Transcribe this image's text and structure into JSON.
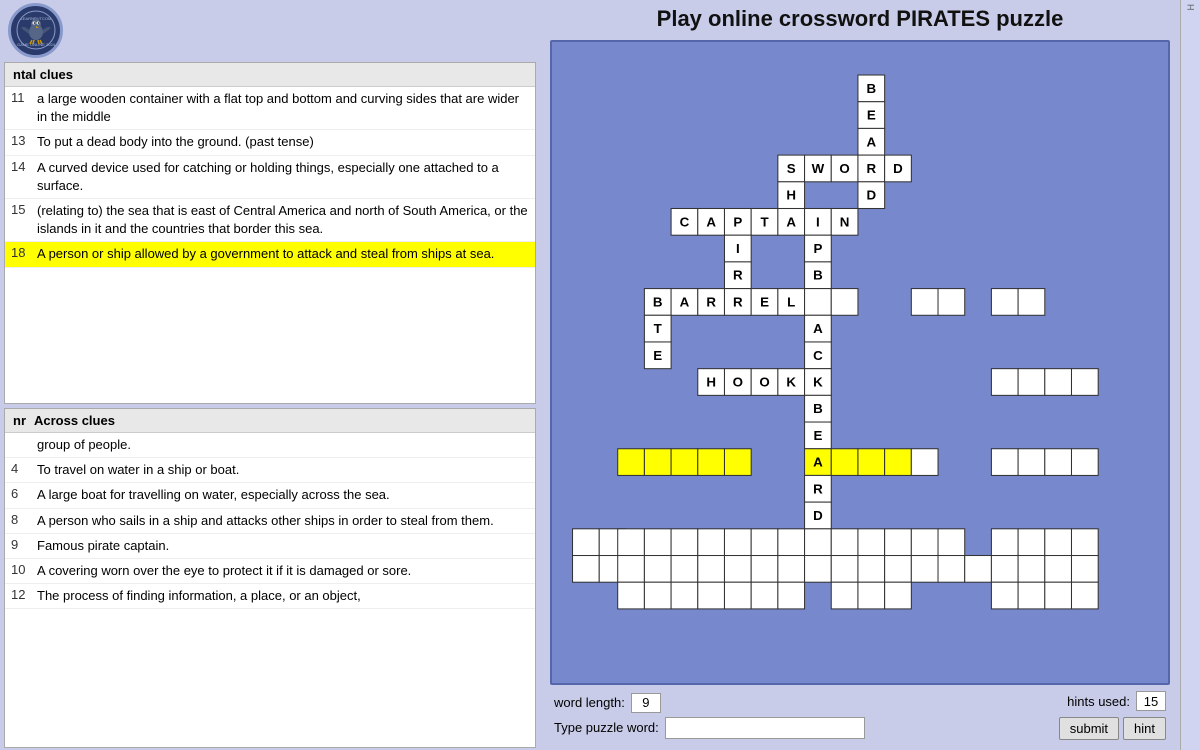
{
  "title": "Play online crossword PIRATES puzzle",
  "logo": {
    "alt": "Learnputcom Game Online 2024"
  },
  "horizontal_clues": {
    "header": "ntal clues",
    "items": [
      {
        "num": "11",
        "text": "a large wooden container with a flat top and bottom and curving sides that are wider in the middle"
      },
      {
        "num": "13",
        "text": "To put a dead body into the ground. (past tense)"
      },
      {
        "num": "14",
        "text": "A curved device used for catching or holding things, especially one attached to a surface."
      },
      {
        "num": "15",
        "text": "(relating to) the sea that is east of Central America and north of South America, or the islands in it and the countries that border this sea."
      },
      {
        "num": "18",
        "text": "A person or ship allowed by a government to attack and steal from ships at sea.",
        "highlighted": true
      }
    ]
  },
  "across_clues": {
    "header": "Across clues",
    "header_num": "nr",
    "items": [
      {
        "num": "",
        "text": "group of people."
      },
      {
        "num": "4",
        "text": "To travel on water in a ship or boat."
      },
      {
        "num": "6",
        "text": "A large boat for travelling on water, especially across the sea."
      },
      {
        "num": "8",
        "text": "A person who sails in a ship and attacks other ships in order to steal from them."
      },
      {
        "num": "9",
        "text": "Famous pirate captain."
      },
      {
        "num": "10",
        "text": "A covering worn over the eye to protect it if it is damaged or sore."
      },
      {
        "num": "12",
        "text": "The process of finding information, a place, or an object,"
      }
    ]
  },
  "bottom": {
    "word_length_label": "word length:",
    "word_length_value": "9",
    "type_label": "Type puzzle word:",
    "type_placeholder": "",
    "hints_used_label": "hints used:",
    "hints_used_value": "15",
    "submit_label": "submit",
    "hint_label": "hint"
  },
  "grid": {
    "cols": 22,
    "rows": 20,
    "cell_size": 28
  }
}
